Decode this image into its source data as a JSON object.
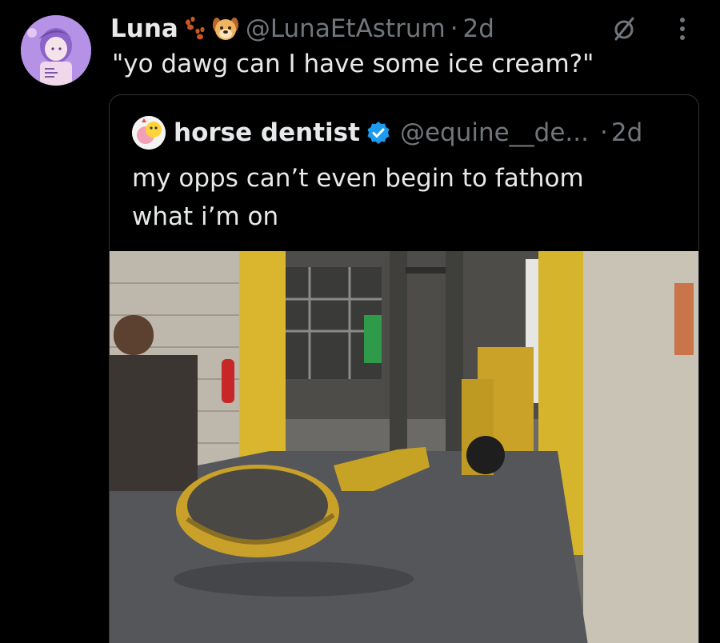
{
  "post": {
    "author_name": "Luna",
    "author_emojis": [
      "paw-prints-emoji",
      "dog-face-emoji"
    ],
    "handle": "@LunaEtAstrum",
    "separator": "·",
    "time": "2d",
    "text": "\"yo dawg can I have some ice cream?\"",
    "icons": [
      "no-entry-icon",
      "more-options-icon"
    ]
  },
  "quoted": {
    "author_name": "horse dentist",
    "verified": true,
    "handle": "@equine__de...",
    "separator": "·",
    "time": "2d",
    "text_lines": [
      "my opps can’t even begin to fathom",
      "what i’m on"
    ],
    "media_alt": "giant-spoon-on-forklift-photo"
  },
  "colors": {
    "background": "#000000",
    "primary_text": "#e7e9ea",
    "secondary_text": "#71767b",
    "verified_blue": "#1d9bf0",
    "border": "#2f3336"
  }
}
